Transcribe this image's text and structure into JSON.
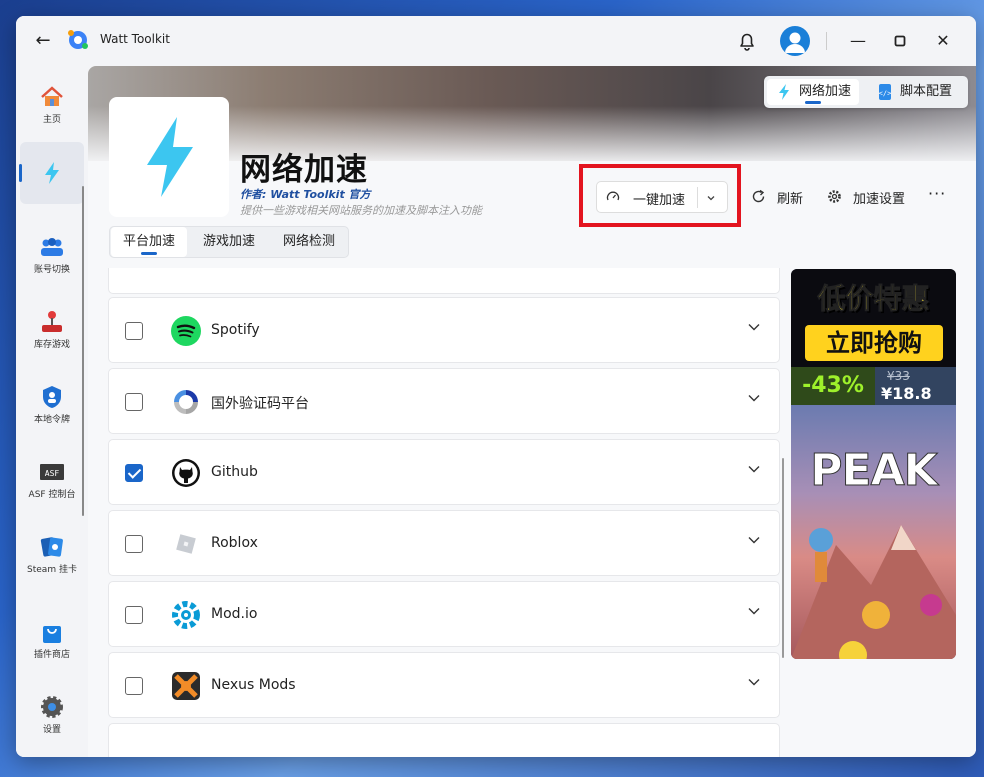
{
  "window": {
    "title": "Watt Toolkit"
  },
  "titlebar": {
    "back_icon": "←",
    "minimize": "—",
    "maximize": "▢",
    "close": "✕"
  },
  "sidebar": {
    "items": [
      {
        "label": "主页",
        "icon": "home-icon"
      },
      {
        "label": "",
        "icon": "lightning-icon"
      },
      {
        "label": "账号切换",
        "icon": "users-icon"
      },
      {
        "label": "库存游戏",
        "icon": "joystick-icon"
      },
      {
        "label": "本地令牌",
        "icon": "shield-icon"
      },
      {
        "label": "ASF 控制台",
        "icon": "asf-icon"
      },
      {
        "label": "Steam 挂卡",
        "icon": "cards-icon"
      },
      {
        "label": "插件商店",
        "icon": "store-bag-icon"
      },
      {
        "label": "设置",
        "icon": "gear-icon"
      }
    ],
    "active_index": 1
  },
  "top_tabs": [
    {
      "label": "网络加速",
      "active": true
    },
    {
      "label": "脚本配置",
      "active": false
    }
  ],
  "header": {
    "title": "网络加速",
    "author": "作者:  Watt Toolkit  官方",
    "description": "提供一些游戏相关网站服务的加速及脚本注入功能"
  },
  "actions": {
    "accelerate": "一键加速",
    "refresh": "刷新",
    "settings": "加速设置",
    "more": "···"
  },
  "sub_tabs": [
    {
      "label": "平台加速",
      "active": true
    },
    {
      "label": "游戏加速",
      "active": false
    },
    {
      "label": "网络检测",
      "active": false
    }
  ],
  "services": [
    {
      "label": "Spotify",
      "checked": false,
      "icon": "spotify-icon"
    },
    {
      "label": "国外验证码平台",
      "checked": false,
      "icon": "recaptcha-icon"
    },
    {
      "label": "Github",
      "checked": true,
      "icon": "github-icon"
    },
    {
      "label": "Roblox",
      "checked": false,
      "icon": "roblox-icon"
    },
    {
      "label": "Mod.io",
      "checked": false,
      "icon": "modio-icon"
    },
    {
      "label": "Nexus Mods",
      "checked": false,
      "icon": "nexus-icon"
    }
  ],
  "ad": {
    "line1": "低价特惠",
    "line2": "立即抢购",
    "discount": "-43%",
    "old_price": "¥33",
    "new_price": "¥18.8",
    "game": "PEAK"
  },
  "colors": {
    "accent": "#1a66c9",
    "highlight": "#e3141f",
    "lightning": "#3cc6f0"
  }
}
